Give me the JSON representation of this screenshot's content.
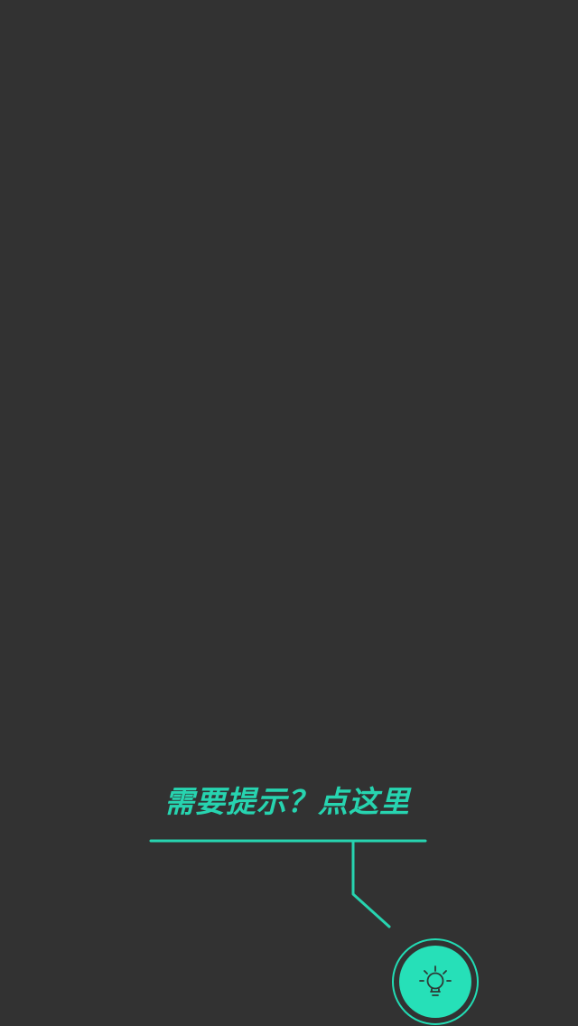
{
  "hint": {
    "prompt_text": "需要提示？点这里"
  },
  "hint_button": {
    "icon": "lightbulb-icon"
  },
  "colors": {
    "background": "#323232",
    "accent": "#26e0b8",
    "accent_text": "#27d4b0",
    "icon_stroke": "#2d3a36"
  }
}
